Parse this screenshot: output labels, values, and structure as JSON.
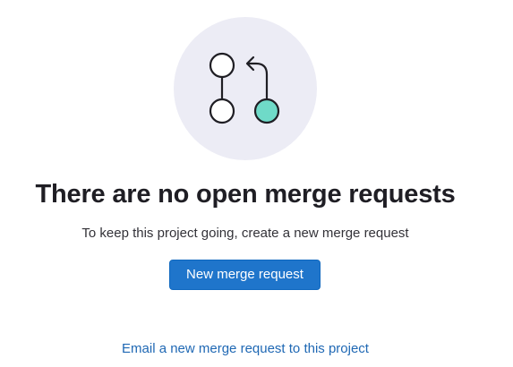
{
  "empty_state": {
    "illustration_icon": "merge-request-icon",
    "title": "There are no open merge requests",
    "description": "To keep this project going, create a new merge request",
    "new_button_label": "New merge request",
    "email_link_label": "Email a new merge request to this project"
  },
  "colors": {
    "illustration_bg": "#ececf5",
    "node_fill_accent": "#6fdac8",
    "primary_button": "#1f75cb",
    "link": "#1f68b4",
    "heading": "#1f1e24"
  }
}
